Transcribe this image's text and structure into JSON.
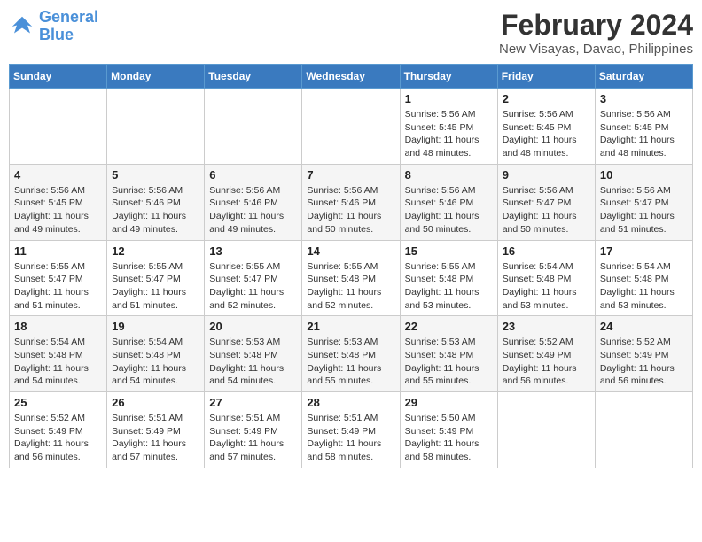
{
  "header": {
    "logo_line1": "General",
    "logo_line2": "Blue",
    "month_year": "February 2024",
    "location": "New Visayas, Davao, Philippines"
  },
  "days_of_week": [
    "Sunday",
    "Monday",
    "Tuesday",
    "Wednesday",
    "Thursday",
    "Friday",
    "Saturday"
  ],
  "weeks": [
    [
      {
        "day": "",
        "info": ""
      },
      {
        "day": "",
        "info": ""
      },
      {
        "day": "",
        "info": ""
      },
      {
        "day": "",
        "info": ""
      },
      {
        "day": "1",
        "info": "Sunrise: 5:56 AM\nSunset: 5:45 PM\nDaylight: 11 hours\nand 48 minutes."
      },
      {
        "day": "2",
        "info": "Sunrise: 5:56 AM\nSunset: 5:45 PM\nDaylight: 11 hours\nand 48 minutes."
      },
      {
        "day": "3",
        "info": "Sunrise: 5:56 AM\nSunset: 5:45 PM\nDaylight: 11 hours\nand 48 minutes."
      }
    ],
    [
      {
        "day": "4",
        "info": "Sunrise: 5:56 AM\nSunset: 5:45 PM\nDaylight: 11 hours\nand 49 minutes."
      },
      {
        "day": "5",
        "info": "Sunrise: 5:56 AM\nSunset: 5:46 PM\nDaylight: 11 hours\nand 49 minutes."
      },
      {
        "day": "6",
        "info": "Sunrise: 5:56 AM\nSunset: 5:46 PM\nDaylight: 11 hours\nand 49 minutes."
      },
      {
        "day": "7",
        "info": "Sunrise: 5:56 AM\nSunset: 5:46 PM\nDaylight: 11 hours\nand 50 minutes."
      },
      {
        "day": "8",
        "info": "Sunrise: 5:56 AM\nSunset: 5:46 PM\nDaylight: 11 hours\nand 50 minutes."
      },
      {
        "day": "9",
        "info": "Sunrise: 5:56 AM\nSunset: 5:47 PM\nDaylight: 11 hours\nand 50 minutes."
      },
      {
        "day": "10",
        "info": "Sunrise: 5:56 AM\nSunset: 5:47 PM\nDaylight: 11 hours\nand 51 minutes."
      }
    ],
    [
      {
        "day": "11",
        "info": "Sunrise: 5:55 AM\nSunset: 5:47 PM\nDaylight: 11 hours\nand 51 minutes."
      },
      {
        "day": "12",
        "info": "Sunrise: 5:55 AM\nSunset: 5:47 PM\nDaylight: 11 hours\nand 51 minutes."
      },
      {
        "day": "13",
        "info": "Sunrise: 5:55 AM\nSunset: 5:47 PM\nDaylight: 11 hours\nand 52 minutes."
      },
      {
        "day": "14",
        "info": "Sunrise: 5:55 AM\nSunset: 5:48 PM\nDaylight: 11 hours\nand 52 minutes."
      },
      {
        "day": "15",
        "info": "Sunrise: 5:55 AM\nSunset: 5:48 PM\nDaylight: 11 hours\nand 53 minutes."
      },
      {
        "day": "16",
        "info": "Sunrise: 5:54 AM\nSunset: 5:48 PM\nDaylight: 11 hours\nand 53 minutes."
      },
      {
        "day": "17",
        "info": "Sunrise: 5:54 AM\nSunset: 5:48 PM\nDaylight: 11 hours\nand 53 minutes."
      }
    ],
    [
      {
        "day": "18",
        "info": "Sunrise: 5:54 AM\nSunset: 5:48 PM\nDaylight: 11 hours\nand 54 minutes."
      },
      {
        "day": "19",
        "info": "Sunrise: 5:54 AM\nSunset: 5:48 PM\nDaylight: 11 hours\nand 54 minutes."
      },
      {
        "day": "20",
        "info": "Sunrise: 5:53 AM\nSunset: 5:48 PM\nDaylight: 11 hours\nand 54 minutes."
      },
      {
        "day": "21",
        "info": "Sunrise: 5:53 AM\nSunset: 5:48 PM\nDaylight: 11 hours\nand 55 minutes."
      },
      {
        "day": "22",
        "info": "Sunrise: 5:53 AM\nSunset: 5:48 PM\nDaylight: 11 hours\nand 55 minutes."
      },
      {
        "day": "23",
        "info": "Sunrise: 5:52 AM\nSunset: 5:49 PM\nDaylight: 11 hours\nand 56 minutes."
      },
      {
        "day": "24",
        "info": "Sunrise: 5:52 AM\nSunset: 5:49 PM\nDaylight: 11 hours\nand 56 minutes."
      }
    ],
    [
      {
        "day": "25",
        "info": "Sunrise: 5:52 AM\nSunset: 5:49 PM\nDaylight: 11 hours\nand 56 minutes."
      },
      {
        "day": "26",
        "info": "Sunrise: 5:51 AM\nSunset: 5:49 PM\nDaylight: 11 hours\nand 57 minutes."
      },
      {
        "day": "27",
        "info": "Sunrise: 5:51 AM\nSunset: 5:49 PM\nDaylight: 11 hours\nand 57 minutes."
      },
      {
        "day": "28",
        "info": "Sunrise: 5:51 AM\nSunset: 5:49 PM\nDaylight: 11 hours\nand 58 minutes."
      },
      {
        "day": "29",
        "info": "Sunrise: 5:50 AM\nSunset: 5:49 PM\nDaylight: 11 hours\nand 58 minutes."
      },
      {
        "day": "",
        "info": ""
      },
      {
        "day": "",
        "info": ""
      }
    ]
  ]
}
